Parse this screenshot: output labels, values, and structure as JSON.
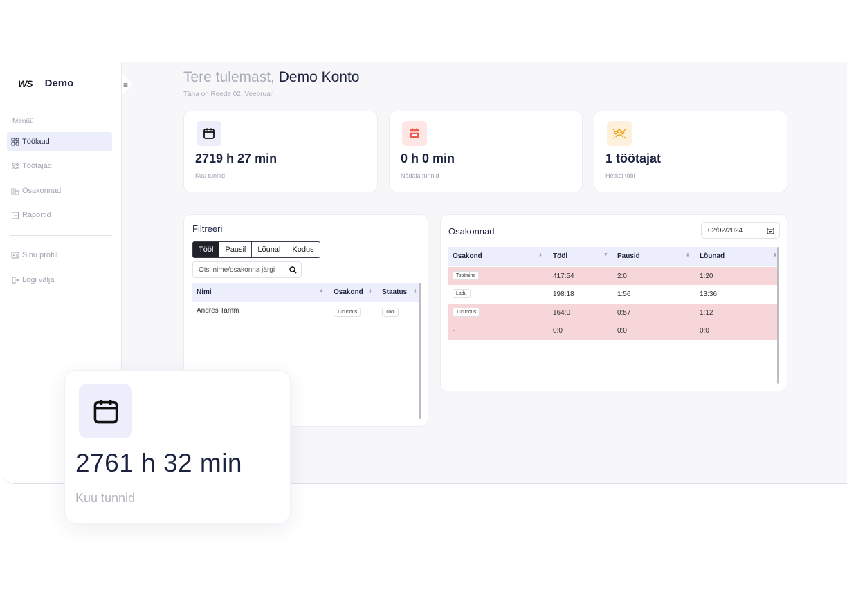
{
  "brand": {
    "logo": "WS",
    "name": "Demo"
  },
  "sidebar": {
    "menu_title": "Menüü",
    "items": [
      {
        "label": "Töölaud",
        "icon": "dashboard-icon",
        "active": true
      },
      {
        "label": "Töötajad",
        "icon": "users-icon",
        "active": false
      },
      {
        "label": "Osakonnad",
        "icon": "building-icon",
        "active": false
      },
      {
        "label": "Raportid",
        "icon": "report-icon",
        "active": false
      }
    ],
    "bottom_items": [
      {
        "label": "Sinu profiil",
        "icon": "profile-icon"
      },
      {
        "label": "Logi välja",
        "icon": "logout-icon"
      }
    ]
  },
  "header": {
    "greeting": "Tere tulemast,",
    "account": "Demo Konto",
    "date_line": "Täna on Reede 02. Veebruar"
  },
  "stats": [
    {
      "value": "2719 h 27 min",
      "label": "Kuu tunnid",
      "icon": "calendar-icon",
      "color": "#eceefb"
    },
    {
      "value": "0 h 0 min",
      "label": "Nädala tunnid",
      "icon": "calendar-minus-icon",
      "color": "#fde6e3"
    },
    {
      "value": "1 töötajat",
      "label": "Hetkel tööl",
      "icon": "team-icon",
      "color": "#fdf1dc"
    }
  ],
  "filter": {
    "title": "Filtreeri",
    "tabs": [
      "Tööl",
      "Pausil",
      "Lõunal",
      "Kodus"
    ],
    "search_placeholder": "Otsi nime/osakonna järgi",
    "columns": [
      "Nimi",
      "Osakond",
      "Staatus"
    ],
    "rows": [
      {
        "name": "Andres Tamm",
        "department": "Turundus",
        "status": "Tööl"
      }
    ]
  },
  "departments": {
    "title": "Osakonnad",
    "date": "02/02/2024",
    "columns": [
      "Osakond",
      "Tööl",
      "Pausid",
      "Lõunad"
    ],
    "rows": [
      {
        "name": "Tootmine",
        "work": "417:54",
        "pauses": "2:0",
        "lunches": "1:20",
        "highlight": true
      },
      {
        "name": "Ladu",
        "work": "198:18",
        "pauses": "1:56",
        "lunches": "13:36",
        "highlight": false
      },
      {
        "name": "Turundus",
        "work": "164:0",
        "pauses": "0:57",
        "lunches": "1:12",
        "highlight": true
      },
      {
        "name": "-",
        "work": "0:0",
        "pauses": "0:0",
        "lunches": "0:0",
        "highlight": true
      }
    ]
  },
  "float_card": {
    "value": "2761 h 32 min",
    "label": "Kuu tunnid",
    "icon": "calendar-icon"
  }
}
